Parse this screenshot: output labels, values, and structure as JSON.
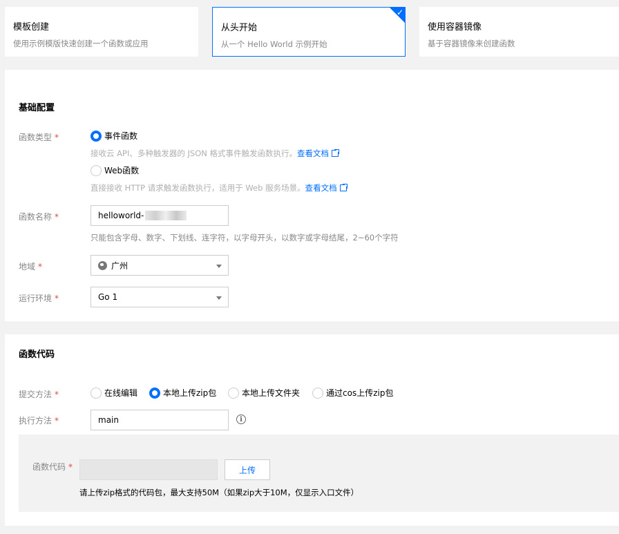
{
  "creation_modes": [
    {
      "title": "模板创建",
      "desc": "使用示例模版快速创建一个函数或应用"
    },
    {
      "title": "从头开始",
      "desc": "从一个 Hello World 示例开始",
      "selected": true
    },
    {
      "title": "使用容器镜像",
      "desc": "基于容器镜像来创建函数"
    }
  ],
  "basic": {
    "section_title": "基础配置",
    "func_type_label": "函数类型",
    "event_option": "事件函数",
    "event_help": "接收云 API、多种触发器的 JSON 格式事件触发函数执行。",
    "web_option": "Web函数",
    "web_help": "直接接收 HTTP 请求触发函数执行，适用于 Web 服务场景。",
    "doc_link": "查看文档",
    "name_label": "函数名称",
    "name_value": "helloworld-",
    "name_help": "只能包含字母、数字、下划线、连字符，以字母开头，以数字或字母结尾，2~60个字符",
    "region_label": "地域",
    "region_value": "广州",
    "runtime_label": "运行环境",
    "runtime_value": "Go 1"
  },
  "code": {
    "section_title": "函数代码",
    "submit_label": "提交方法",
    "submit_options": [
      "在线编辑",
      "本地上传zip包",
      "本地上传文件夹",
      "通过cos上传zip包"
    ],
    "exec_label": "执行方法",
    "exec_value": "main",
    "code_label": "函数代码",
    "upload_button": "上传",
    "upload_help": "请上传zip格式的代码包，最大支持50M（如果zip大于10M，仅显示入口文件）"
  },
  "required_mark": "*",
  "colors": {
    "accent": "#006eff",
    "required": "#e54545"
  }
}
